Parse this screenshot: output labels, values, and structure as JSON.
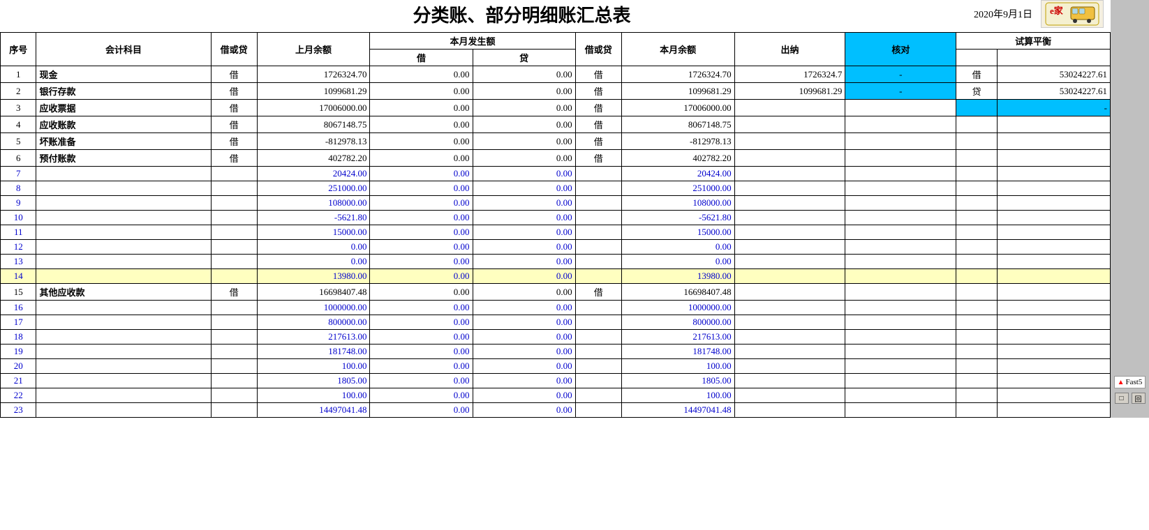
{
  "header": {
    "title": "分类账、部分明细账汇总表",
    "date": "2020年9月1日",
    "logo_text": "e家"
  },
  "table_headers": {
    "seq": "序号",
    "account": "会计科目",
    "dc1": "借或贷",
    "prev_balance": "上月余额",
    "current_period": "本月发生额",
    "debit": "借",
    "credit": "贷",
    "dc2": "借或贷",
    "curr_balance": "本月余额",
    "cashier": "出纳",
    "verify": "核对",
    "trial": "试算平衡"
  },
  "trial_rows": [
    {
      "label": "借",
      "value": "53024227.61"
    },
    {
      "label": "贷",
      "value": "53024227.61"
    },
    {
      "label": "",
      "value": "-"
    }
  ],
  "rows": [
    {
      "seq": "1",
      "account": "现金",
      "dc1": "借",
      "prev": "1726324.70",
      "debit": "0.00",
      "credit": "0.00",
      "dc2": "借",
      "curr": "1726324.70",
      "cashier": "1726324.7",
      "verify": "-",
      "style": "normal"
    },
    {
      "seq": "2",
      "account": "银行存款",
      "dc1": "借",
      "prev": "1099681.29",
      "debit": "0.00",
      "credit": "0.00",
      "dc2": "借",
      "curr": "1099681.29",
      "cashier": "1099681.29",
      "verify": "-",
      "style": "normal"
    },
    {
      "seq": "3",
      "account": "应收票据",
      "dc1": "借",
      "prev": "17006000.00",
      "debit": "0.00",
      "credit": "0.00",
      "dc2": "借",
      "curr": "17006000.00",
      "cashier": "",
      "verify": "",
      "style": "normal"
    },
    {
      "seq": "4",
      "account": "应收账款",
      "dc1": "借",
      "prev": "8067148.75",
      "debit": "0.00",
      "credit": "0.00",
      "dc2": "借",
      "curr": "8067148.75",
      "cashier": "",
      "verify": "",
      "style": "normal"
    },
    {
      "seq": "5",
      "account": "坏账准备",
      "dc1": "借",
      "prev": "-812978.13",
      "debit": "0.00",
      "credit": "0.00",
      "dc2": "借",
      "curr": "-812978.13",
      "cashier": "",
      "verify": "",
      "style": "normal"
    },
    {
      "seq": "6",
      "account": "预付账款",
      "dc1": "借",
      "prev": "402782.20",
      "debit": "0.00",
      "credit": "0.00",
      "dc2": "借",
      "curr": "402782.20",
      "cashier": "",
      "verify": "",
      "style": "normal"
    },
    {
      "seq": "7",
      "account": "",
      "dc1": "",
      "prev": "20424.00",
      "debit": "0.00",
      "credit": "0.00",
      "dc2": "",
      "curr": "20424.00",
      "cashier": "",
      "verify": "",
      "style": "blue"
    },
    {
      "seq": "8",
      "account": "",
      "dc1": "",
      "prev": "251000.00",
      "debit": "0.00",
      "credit": "0.00",
      "dc2": "",
      "curr": "251000.00",
      "cashier": "",
      "verify": "",
      "style": "blue"
    },
    {
      "seq": "9",
      "account": "",
      "dc1": "",
      "prev": "108000.00",
      "debit": "0.00",
      "credit": "0.00",
      "dc2": "",
      "curr": "108000.00",
      "cashier": "",
      "verify": "",
      "style": "blue"
    },
    {
      "seq": "10",
      "account": "",
      "dc1": "",
      "prev": "-5621.80",
      "debit": "0.00",
      "credit": "0.00",
      "dc2": "",
      "curr": "-5621.80",
      "cashier": "",
      "verify": "",
      "style": "blue"
    },
    {
      "seq": "11",
      "account": "",
      "dc1": "",
      "prev": "15000.00",
      "debit": "0.00",
      "credit": "0.00",
      "dc2": "",
      "curr": "15000.00",
      "cashier": "",
      "verify": "",
      "style": "blue"
    },
    {
      "seq": "12",
      "account": "",
      "dc1": "",
      "prev": "0.00",
      "debit": "0.00",
      "credit": "0.00",
      "dc2": "",
      "curr": "0.00",
      "cashier": "",
      "verify": "",
      "style": "blue"
    },
    {
      "seq": "13",
      "account": "",
      "dc1": "",
      "prev": "0.00",
      "debit": "0.00",
      "credit": "0.00",
      "dc2": "",
      "curr": "0.00",
      "cashier": "",
      "verify": "",
      "style": "blue"
    },
    {
      "seq": "14",
      "account": "",
      "dc1": "",
      "prev": "13980.00",
      "debit": "0.00",
      "credit": "0.00",
      "dc2": "",
      "curr": "13980.00",
      "cashier": "",
      "verify": "",
      "style": "yellow"
    },
    {
      "seq": "15",
      "account": "其他应收款",
      "dc1": "借",
      "prev": "16698407.48",
      "debit": "0.00",
      "credit": "0.00",
      "dc2": "借",
      "curr": "16698407.48",
      "cashier": "",
      "verify": "",
      "style": "normal"
    },
    {
      "seq": "16",
      "account": "",
      "dc1": "",
      "prev": "1000000.00",
      "debit": "0.00",
      "credit": "0.00",
      "dc2": "",
      "curr": "1000000.00",
      "cashier": "",
      "verify": "",
      "style": "blue"
    },
    {
      "seq": "17",
      "account": "",
      "dc1": "",
      "prev": "800000.00",
      "debit": "0.00",
      "credit": "0.00",
      "dc2": "",
      "curr": "800000.00",
      "cashier": "",
      "verify": "",
      "style": "blue"
    },
    {
      "seq": "18",
      "account": "",
      "dc1": "",
      "prev": "217613.00",
      "debit": "0.00",
      "credit": "0.00",
      "dc2": "",
      "curr": "217613.00",
      "cashier": "",
      "verify": "",
      "style": "blue"
    },
    {
      "seq": "19",
      "account": "",
      "dc1": "",
      "prev": "181748.00",
      "debit": "0.00",
      "credit": "0.00",
      "dc2": "",
      "curr": "181748.00",
      "cashier": "",
      "verify": "",
      "style": "blue"
    },
    {
      "seq": "20",
      "account": "",
      "dc1": "",
      "prev": "100.00",
      "debit": "0.00",
      "credit": "0.00",
      "dc2": "",
      "curr": "100.00",
      "cashier": "",
      "verify": "",
      "style": "blue"
    },
    {
      "seq": "21",
      "account": "",
      "dc1": "",
      "prev": "1805.00",
      "debit": "0.00",
      "credit": "0.00",
      "dc2": "",
      "curr": "1805.00",
      "cashier": "",
      "verify": "",
      "style": "blue"
    },
    {
      "seq": "22",
      "account": "",
      "dc1": "",
      "prev": "100.00",
      "debit": "0.00",
      "credit": "0.00",
      "dc2": "",
      "curr": "100.00",
      "cashier": "",
      "verify": "",
      "style": "blue"
    },
    {
      "seq": "23",
      "account": "",
      "dc1": "",
      "prev": "14497041.48",
      "debit": "0.00",
      "credit": "0.00",
      "dc2": "",
      "curr": "14497041.48",
      "cashier": "",
      "verify": "",
      "style": "blue"
    }
  ],
  "sidebar": {
    "fast5_label": "Fast5",
    "btn1": "□",
    "btn2": "回"
  }
}
